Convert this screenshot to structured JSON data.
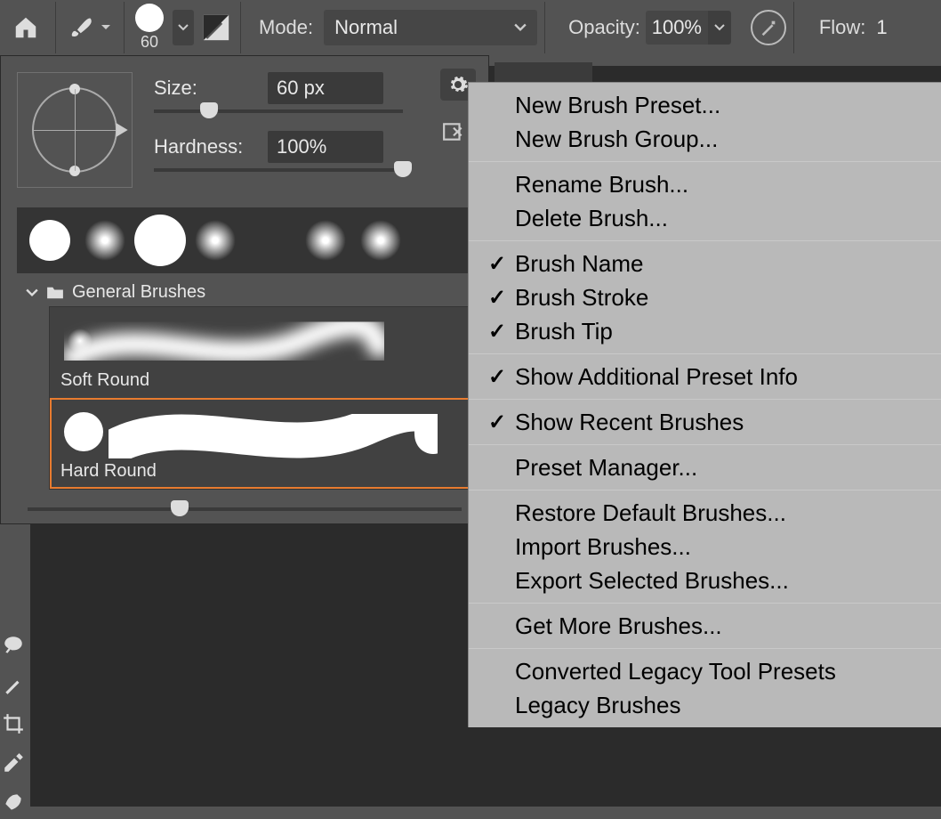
{
  "toolbar": {
    "mode_label": "Mode:",
    "mode_value": "Normal",
    "opacity_label": "Opacity:",
    "opacity_value": "100%",
    "flow_label": "Flow:",
    "flow_value": "1",
    "brush_size_display": "60"
  },
  "brush_panel": {
    "size_label": "Size:",
    "size_value": "60 px",
    "size_slider_pct": 22,
    "hardness_label": "Hardness:",
    "hardness_value": "100%",
    "hardness_slider_pct": 100,
    "group_name": "General Brushes",
    "presets": [
      {
        "label": "Soft Round",
        "selected": false
      },
      {
        "label": "Hard Round",
        "selected": true
      }
    ],
    "bottom_slider_pct": 35
  },
  "recent_brushes": [
    {
      "type": "hard"
    },
    {
      "type": "soft"
    },
    {
      "type": "hard_big"
    },
    {
      "type": "soft"
    },
    {
      "type": "empty"
    },
    {
      "type": "soft"
    },
    {
      "type": "soft"
    }
  ],
  "context_menu": {
    "groups": [
      [
        {
          "label": "New Brush Preset...",
          "checked": false
        },
        {
          "label": "New Brush Group...",
          "checked": false
        }
      ],
      [
        {
          "label": "Rename Brush...",
          "checked": false
        },
        {
          "label": "Delete Brush...",
          "checked": false
        }
      ],
      [
        {
          "label": "Brush Name",
          "checked": true
        },
        {
          "label": "Brush Stroke",
          "checked": true
        },
        {
          "label": "Brush Tip",
          "checked": true
        }
      ],
      [
        {
          "label": "Show Additional Preset Info",
          "checked": true
        }
      ],
      [
        {
          "label": "Show Recent Brushes",
          "checked": true
        }
      ],
      [
        {
          "label": "Preset Manager...",
          "checked": false
        }
      ],
      [
        {
          "label": "Restore Default Brushes...",
          "checked": false
        },
        {
          "label": "Import Brushes...",
          "checked": false
        },
        {
          "label": "Export Selected Brushes...",
          "checked": false
        }
      ],
      [
        {
          "label": "Get More Brushes...",
          "checked": false
        }
      ],
      [
        {
          "label": "Converted Legacy Tool Presets",
          "checked": false
        },
        {
          "label": "Legacy Brushes",
          "checked": false
        }
      ]
    ]
  }
}
